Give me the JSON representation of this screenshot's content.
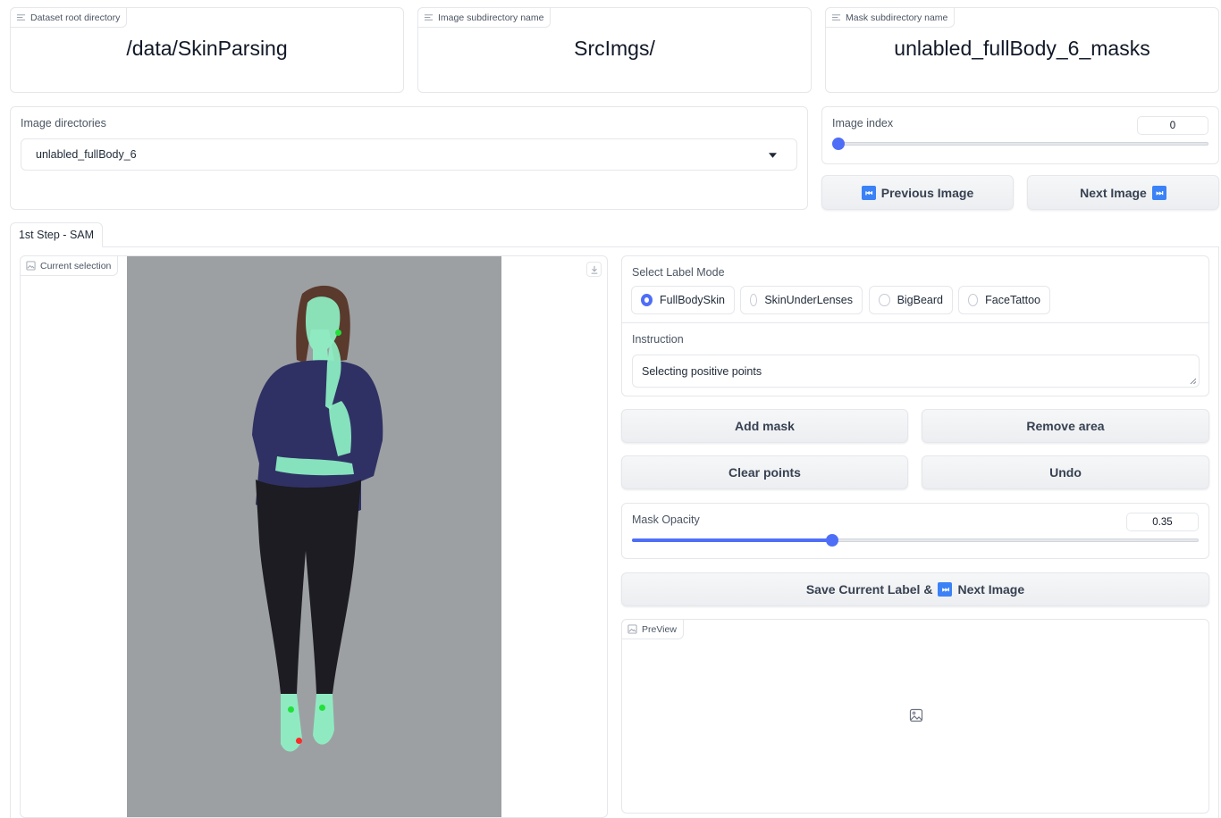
{
  "top_fields": [
    {
      "label": "Dataset root directory",
      "value": "/data/SkinParsing"
    },
    {
      "label": "Image subdirectory name",
      "value": "SrcImgs/"
    },
    {
      "label": "Mask subdirectory name",
      "value": "unlabled_fullBody_6_masks"
    }
  ],
  "image_directories": {
    "label": "Image directories",
    "selected": "unlabled_fullBody_6"
  },
  "image_index": {
    "label": "Image index",
    "value": "0",
    "fraction": 0
  },
  "nav": {
    "prev_icon": "⏮",
    "prev_label": "Previous Image",
    "next_label": "Next Image",
    "next_icon": "⏭"
  },
  "tabs": [
    {
      "label": "1st Step - SAM"
    }
  ],
  "current_selection": {
    "label": "Current selection"
  },
  "label_mode": {
    "label": "Select Label Mode",
    "options": [
      "FullBodySkin",
      "SkinUnderLenses",
      "BigBeard",
      "FaceTattoo"
    ],
    "selected": "FullBodySkin"
  },
  "instruction": {
    "label": "Instruction",
    "value": "Selecting positive points"
  },
  "buttons": {
    "add_mask": "Add mask",
    "remove_area": "Remove area",
    "clear_points": "Clear points",
    "undo": "Undo"
  },
  "mask_opacity": {
    "label": "Mask Opacity",
    "value": "0.35",
    "fraction": 0.35
  },
  "save": {
    "prefix": "Save Current Label &",
    "icon": "⏭",
    "suffix": "Next Image"
  },
  "preview": {
    "label": "PreView"
  },
  "colors": {
    "accent": "#4f6ef7",
    "positive_point": "#22e03a",
    "negative_point": "#ff2a2a",
    "mask": "#8ef0c4"
  },
  "icons": [
    "text-field-icon",
    "image-icon",
    "download-icon",
    "chevron-down-icon",
    "media-skip-icon",
    "image-placeholder-icon"
  ]
}
